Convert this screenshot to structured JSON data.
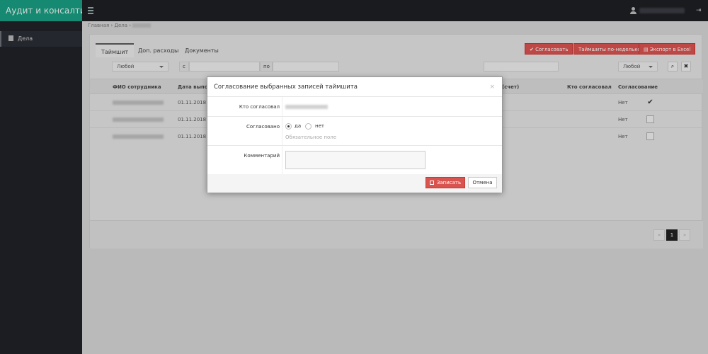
{
  "app": {
    "title": "Аудит и консалтинг"
  },
  "sidebar": {
    "items": [
      {
        "label": "Дела"
      }
    ]
  },
  "breadcrumb": {
    "home": "Главная",
    "section": "Дела",
    "sep": "›"
  },
  "tabs": [
    {
      "label": "Таймшит"
    },
    {
      "label": "Доп. расходы"
    },
    {
      "label": "Документы"
    }
  ],
  "toolbar": {
    "approve_label": "Согласовать",
    "weekly_label": "Таймшиты по-неделько",
    "excel_label": "Экспорт в Excel"
  },
  "filters": {
    "status_left": "Любой",
    "from_label": "с",
    "to_label": "по",
    "status_right": "Любой"
  },
  "table": {
    "columns": [
      "ФИО сотрудника",
      "Дата выпол",
      "(счет)",
      "Кто согласовал",
      "Согласование"
    ],
    "rows": [
      {
        "date": "01.11.2018",
        "approval": "Нет",
        "checked": true
      },
      {
        "date": "01.11.2018",
        "approval": "Нет",
        "checked": false
      },
      {
        "date": "01.11.2018",
        "approval": "Нет",
        "checked": false
      }
    ]
  },
  "pagination": {
    "prev": "«",
    "current": "1",
    "next": "»"
  },
  "modal": {
    "title": "Согласование выбранных записей таймшита",
    "close": "×",
    "approver_label": "Кто согласовал",
    "approved_label": "Согласовано",
    "yes_label": "да",
    "no_label": "нет",
    "required_hint": "Обязательное поле",
    "comment_label": "Комментарий",
    "save_label": "Записать",
    "cancel_label": "Отмена",
    "selected_option": "да"
  },
  "colors": {
    "brand": "#189d81",
    "accent": "#d9534f",
    "topbar": "#1e1f24"
  }
}
